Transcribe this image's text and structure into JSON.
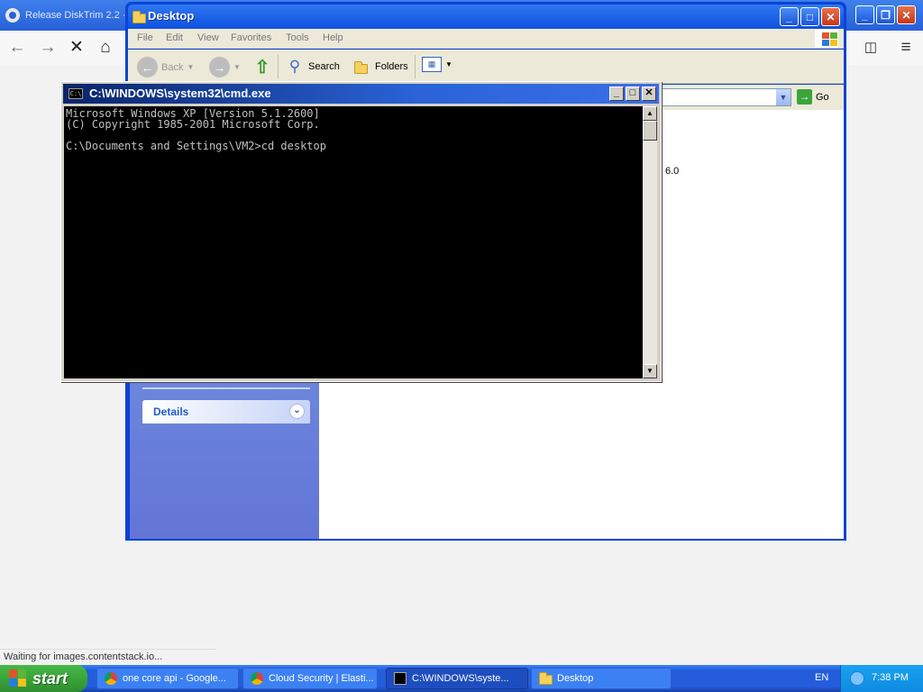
{
  "browser": {
    "tab_title": "Release DiskTrim 2.2 ·",
    "status_text": "Waiting for images.contentstack.io..."
  },
  "explorer": {
    "title": "Desktop",
    "menu": [
      "File",
      "Edit",
      "View",
      "Favorites",
      "Tools",
      "Help"
    ],
    "toolbar": {
      "back_label": "Back",
      "search_label": "Search",
      "folders_label": "Folders"
    },
    "go_label": "Go",
    "details_label": "Details",
    "version_fragment": "6.0"
  },
  "cmd": {
    "title": "C:\\WINDOWS\\system32\\cmd.exe",
    "lines": [
      "Microsoft Windows XP [Version 5.1.2600]",
      "(C) Copyright 1985-2001 Microsoft Corp.",
      "",
      "C:\\Documents and Settings\\VM2>cd desktop"
    ]
  },
  "taskbar": {
    "start_label": "start",
    "tasks": [
      {
        "label": "one core api - Google...",
        "icon": "chrome-icon"
      },
      {
        "label": "Cloud Security | Elasti...",
        "icon": "chrome-icon"
      },
      {
        "label": "C:\\WINDOWS\\syste...",
        "icon": "cmd-icon"
      },
      {
        "label": "Desktop",
        "icon": "folder-icon"
      }
    ],
    "language": "EN",
    "clock": "7:38 PM"
  }
}
